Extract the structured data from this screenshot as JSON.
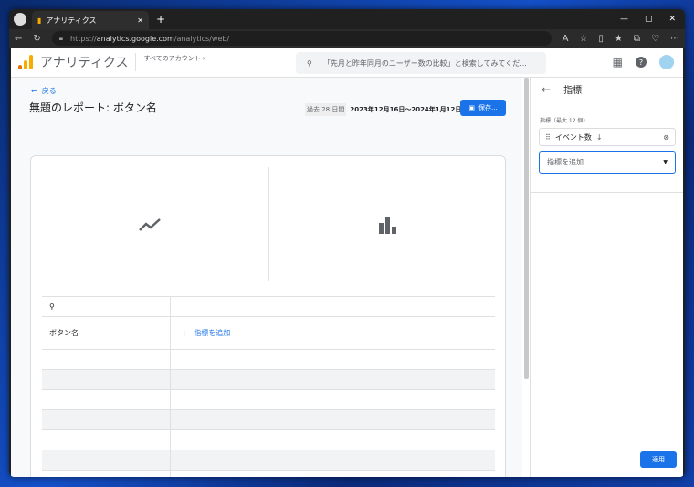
{
  "browser": {
    "tab_title": "アナリティクス",
    "url_prefix": "https://",
    "url_host": "analytics.google.com",
    "url_path": "/analytics/web/"
  },
  "header": {
    "brand": "アナリティクス",
    "account": "すべてのアカウント ›",
    "search_placeholder": "「先月と昨年同月のユーザー数の比較」と検索してみてくだ..."
  },
  "report": {
    "back": "戻る",
    "title": "無題のレポート: ボタン名",
    "date_range_label": "過去 28 日間",
    "date_range": "2023年12月16日～2024年1月12日",
    "save": "保存..."
  },
  "table": {
    "dimension": "ボタン名",
    "add_metric": "指標を追加"
  },
  "panel": {
    "title": "指標",
    "label": "指標（最大 12 個）",
    "metric": "イベント数",
    "add_placeholder": "指標を追加",
    "apply": "適用"
  }
}
